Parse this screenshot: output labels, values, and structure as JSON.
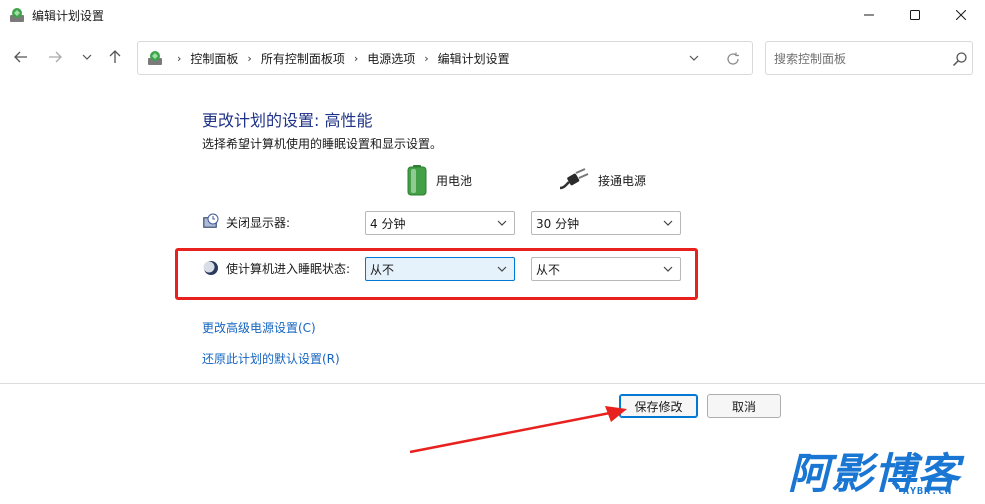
{
  "window": {
    "title": "编辑计划设置"
  },
  "navigation": {
    "breadcrumbs": [
      {
        "label": "控制面板"
      },
      {
        "label": "所有控制面板项"
      },
      {
        "label": "电源选项"
      },
      {
        "label": "编辑计划设置"
      }
    ],
    "search_placeholder": "搜索控制面板"
  },
  "main": {
    "title": "更改计划的设置: 高性能",
    "subtitle": "选择希望计算机使用的睡眠设置和显示设置。",
    "columns": {
      "battery": "用电池",
      "plugged_in": "接通电源"
    },
    "settings": [
      {
        "label": "关闭显示器:",
        "battery_value": "4 分钟",
        "plugged_value": "30 分钟"
      },
      {
        "label": "使计算机进入睡眠状态:",
        "battery_value": "从不",
        "plugged_value": "从不"
      }
    ],
    "links": {
      "advanced": "更改高级电源设置(C)",
      "restore": "还原此计划的默认设置(R)"
    }
  },
  "buttons": {
    "save": "保存修改",
    "cancel": "取消"
  },
  "watermark": {
    "text": "阿影博客",
    "sub": "AYBK.CN"
  },
  "colors": {
    "accent": "#0078d4",
    "title": "#1e3287",
    "link": "#1565c0",
    "highlight": "#e8211e",
    "watermark": "#1976d2"
  }
}
